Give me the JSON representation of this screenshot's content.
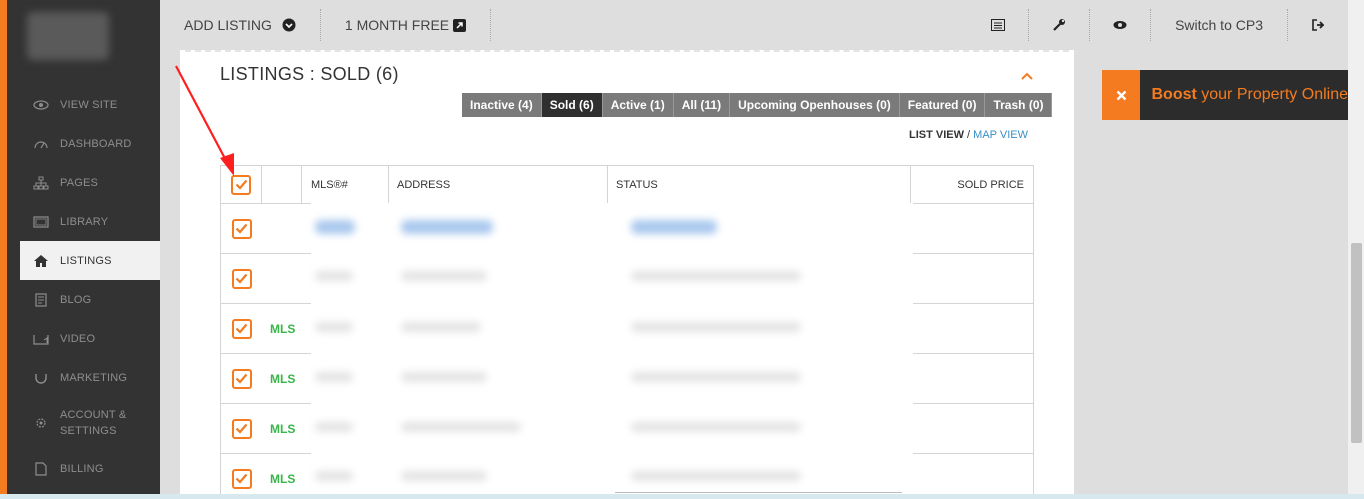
{
  "topbar": {
    "add_listing": "ADD LISTING",
    "month_free": "1 MONTH FREE",
    "switch_cp3": "Switch to CP3"
  },
  "sidebar": {
    "items": [
      {
        "label": "VIEW SITE",
        "icon": "eye-icon"
      },
      {
        "label": "DASHBOARD",
        "icon": "gauge-icon"
      },
      {
        "label": "PAGES",
        "icon": "sitemap-icon"
      },
      {
        "label": "LIBRARY",
        "icon": "image-icon"
      },
      {
        "label": "LISTINGS",
        "icon": "home-icon",
        "active": true
      },
      {
        "label": "BLOG",
        "icon": "document-icon"
      },
      {
        "label": "VIDEO",
        "icon": "video-icon"
      },
      {
        "label": "MARKETING",
        "icon": "magnet-icon"
      },
      {
        "label": "ACCOUNT &",
        "label2": "SETTINGS",
        "icon": "gear-icon"
      },
      {
        "label": "BILLING",
        "icon": "file-icon"
      }
    ]
  },
  "main": {
    "title": "LISTINGS : SOLD (6)",
    "filters": [
      {
        "label": "Inactive (4)",
        "active": false
      },
      {
        "label": "Sold (6)",
        "active": true
      },
      {
        "label": "Active (1)",
        "active": false
      },
      {
        "label": "All (11)",
        "active": false
      },
      {
        "label": "Upcoming Openhouses (0)",
        "active": false
      },
      {
        "label": "Featured (0)",
        "active": false
      },
      {
        "label": "Trash (0)",
        "active": false
      }
    ],
    "list_view": "LIST VIEW",
    "view_sep": " / ",
    "map_view": "MAP VIEW",
    "table": {
      "headers": [
        "",
        "",
        "MLS®#",
        "ADDRESS",
        "STATUS",
        "SOLD PRICE"
      ],
      "rows": [
        {
          "badge": "",
          "checked": true
        },
        {
          "badge": "",
          "checked": true
        },
        {
          "badge": "MLS",
          "checked": true
        },
        {
          "badge": "MLS",
          "checked": true
        },
        {
          "badge": "MLS",
          "checked": true
        },
        {
          "badge": "MLS",
          "checked": true
        }
      ]
    }
  },
  "boost": {
    "bold": "Boost",
    "rest": " your Property Online"
  },
  "colors": {
    "accent": "#f47b20",
    "sidebar": "#333333",
    "mls_green": "#39b54a",
    "link_blue": "#3a8fc7"
  }
}
